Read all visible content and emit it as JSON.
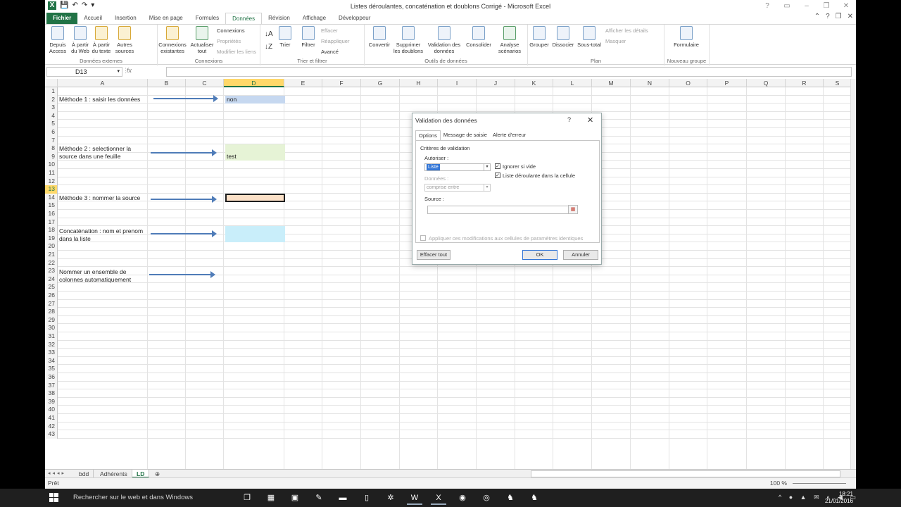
{
  "window": {
    "title": "Listes déroulantes, concaténation et doublons Corrigé - Microsoft Excel"
  },
  "ribbon_tabs": [
    "Fichier",
    "Accueil",
    "Insertion",
    "Mise en page",
    "Formules",
    "Données",
    "Révision",
    "Affichage",
    "Développeur"
  ],
  "active_tab": "Données",
  "groups": {
    "ext": {
      "label": "Données externes",
      "b1": "Depuis Access",
      "b2": "À partir du Web",
      "b3": "À partir du texte",
      "b4": "Autres sources"
    },
    "conn": {
      "label": "Connexions",
      "b1": "Connexions existantes",
      "b2": "Actualiser tout",
      "s1": "Connexions",
      "s2": "Propriétés",
      "s3": "Modifier les liens"
    },
    "sort": {
      "label": "Trier et filtrer",
      "b1": "Trier",
      "b2": "Filtrer",
      "s1": "Effacer",
      "s2": "Réappliquer",
      "s3": "Avancé"
    },
    "tools": {
      "label": "Outils de données",
      "b1": "Convertir",
      "b2": "Supprimer les doublons",
      "b3": "Validation des données",
      "b4": "Consolider",
      "b5": "Analyse scénarios"
    },
    "plan": {
      "label": "Plan",
      "b1": "Grouper",
      "b2": "Dissocier",
      "b3": "Sous-total",
      "s1": "Afficher les détails",
      "s2": "Masquer"
    },
    "newgrp": {
      "label": "Nouveau groupe",
      "b1": "Formulaire"
    }
  },
  "formula_bar": {
    "name_box": "D13",
    "fx": "fx",
    "value": ""
  },
  "columns": [
    "A",
    "B",
    "C",
    "D",
    "E",
    "F",
    "G",
    "H",
    "I",
    "J",
    "K",
    "L",
    "M",
    "N",
    "O",
    "P",
    "Q",
    "R",
    "S"
  ],
  "selected_column": "D",
  "rows": [
    "1",
    "2",
    "3",
    "4",
    "5",
    "6",
    "7",
    "8",
    "9",
    "10",
    "11",
    "12",
    "13",
    "14",
    "15",
    "16",
    "17",
    "18",
    "19",
    "20",
    "21",
    "22",
    "23",
    "24",
    "25",
    "26",
    "27",
    "28",
    "29",
    "30",
    "31",
    "32",
    "33",
    "34",
    "35",
    "36",
    "37",
    "38",
    "39",
    "40",
    "41",
    "42",
    "43"
  ],
  "selected_row": "13",
  "cells": {
    "a2": "Méthode 1 : saisir les données",
    "d2": "non",
    "a8": "Méthode 2 : selectionner la source dans une feuille",
    "d8": "test",
    "a13": "Méthode 3 : nommer la source",
    "a17": "Concaténation : nom et prenom dans la liste",
    "a21": "Nommer un ensemble de colonnes automatiquement"
  },
  "fills": {
    "d2": "#c6d8f0",
    "d8": "#e6f3d6",
    "d13": "#fbe0c7",
    "d17": "#c9eefa"
  },
  "sheets": [
    "bdd",
    "Adhérents",
    "LD"
  ],
  "active_sheet": "LD",
  "status": {
    "ready": "Prêt",
    "zoom": "100 %"
  },
  "taskbar": {
    "search": "Rechercher sur le web et dans Windows",
    "time": "18:21",
    "date": "21/01/2016"
  },
  "dialog": {
    "title": "Validation des données",
    "help": "?",
    "close": "✕",
    "tabs": [
      "Options",
      "Message de saisie",
      "Alerte d'erreur"
    ],
    "section": "Critères de validation",
    "allow_label": "Autoriser :",
    "allow_value": "Liste",
    "ignore_blank": "Ignorer si vide",
    "dropdown_in_cell": "Liste déroulante dans la cellule",
    "data_label": "Données :",
    "data_value": "comprise entre",
    "source_label": "Source :",
    "source_value": "",
    "apply_all": "Appliquer ces modifications aux cellules de paramètres identiques",
    "clear_all": "Effacer tout",
    "ok": "OK",
    "cancel": "Annuler"
  }
}
